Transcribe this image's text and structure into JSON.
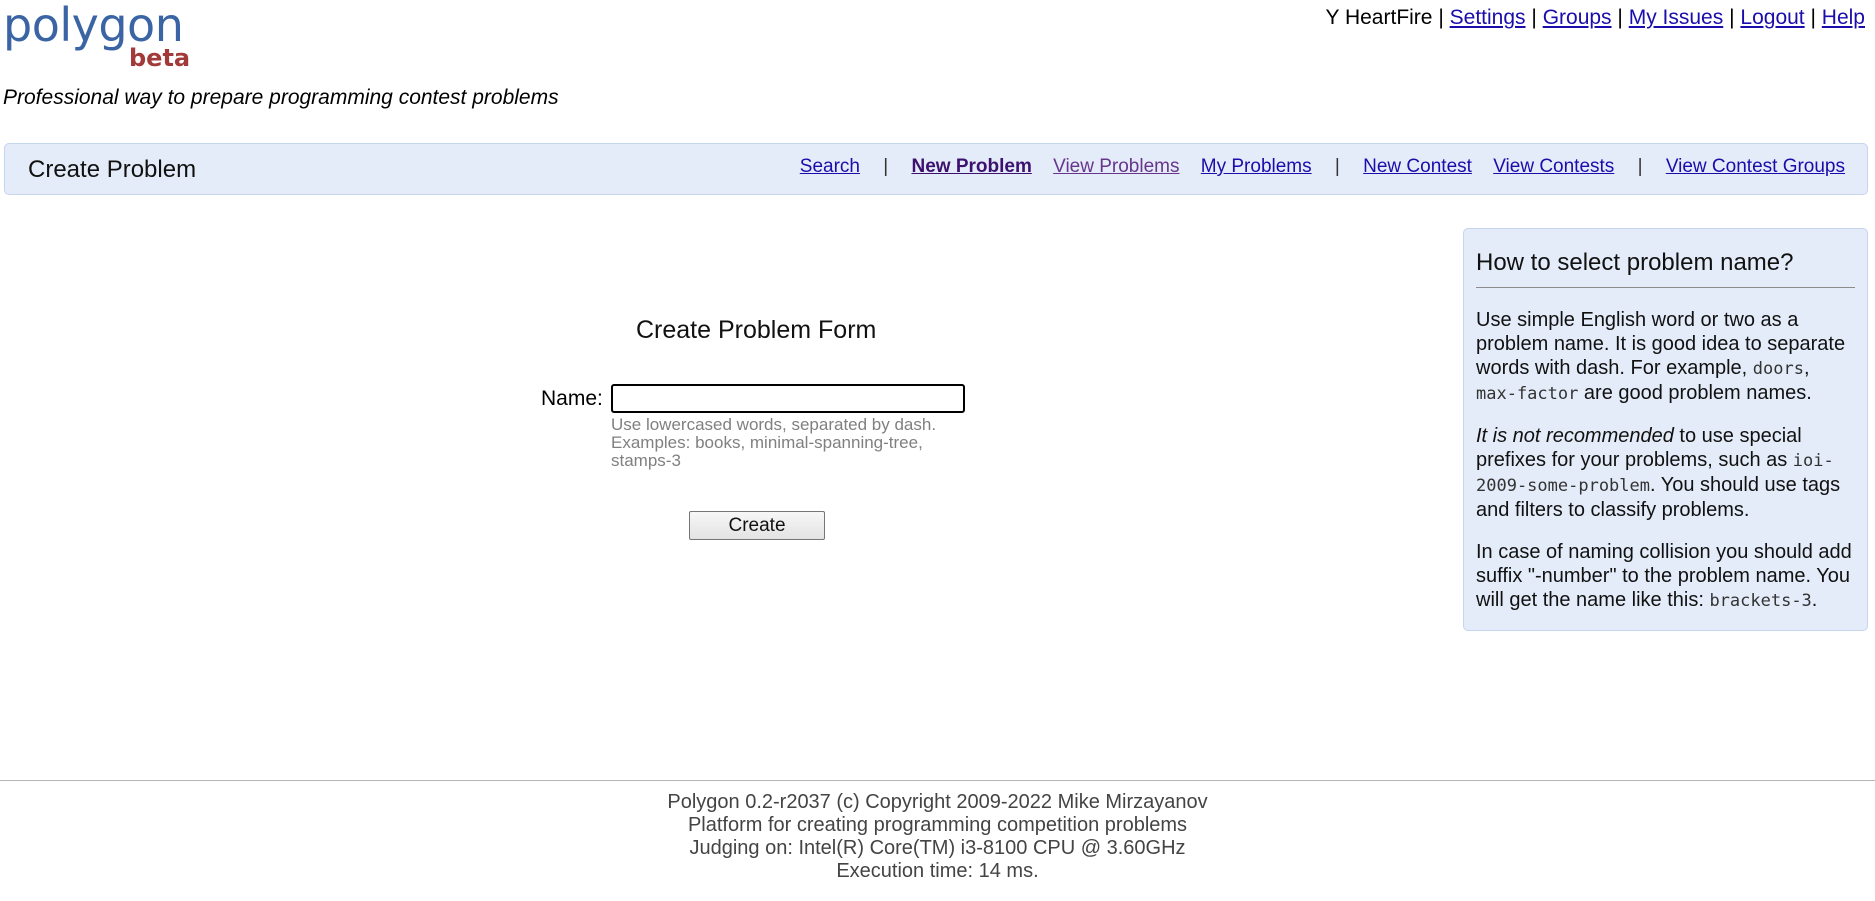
{
  "logo": {
    "word": "polygon",
    "badge": "beta"
  },
  "tagline": "Professional way to prepare programming contest problems",
  "topnav": {
    "user": "Y HeartFire",
    "sep": "|",
    "settings": "Settings",
    "groups": "Groups",
    "my_issues": "My Issues",
    "logout": "Logout",
    "help": "Help"
  },
  "second_bar": {
    "title": "Create Problem",
    "menu": {
      "search": "Search",
      "new_problem": "New Problem",
      "view_problems": "View Problems",
      "my_problems": "My Problems",
      "new_contest": "New Contest",
      "view_contests": "View Contests",
      "view_contest_groups": "View Contest Groups",
      "sep": "|"
    }
  },
  "form": {
    "title": "Create Problem Form",
    "name_label": "Name:",
    "name_value": "",
    "hint": "Use lowercased words, separated by dash. Examples: books, minimal-spanning-tree, stamps-3",
    "submit": "Create"
  },
  "sidebar": {
    "title": "How to select problem name?",
    "p1_text": "Use simple English word or two as a problem name. It is good idea to separate words with dash. For example, ",
    "p1_code1": "doors",
    "p1_comma": ", ",
    "p1_code2": "max-factor",
    "p1_end": " are good problem names.",
    "p2_em": "It is not recommended",
    "p2_text": " to use special prefixes for your problems, such as ",
    "p2_code": "ioi-2009-some-problem",
    "p2_end": ". You should use tags and filters to classify problems.",
    "p3_text": "In case of naming collision you should add suffix \"-number\" to the problem name. You will get the name like this: ",
    "p3_code": "brackets-3",
    "p3_end": "."
  },
  "footer": {
    "line1": "Polygon 0.2-r2037 (c) Copyright 2009-2022 Mike Mirzayanov",
    "line2": "Platform for creating programming competition problems",
    "line3": "Judging on: Intel(R) Core(TM) i3-8100 CPU @ 3.60GHz",
    "line4": "Execution time: 14 ms."
  }
}
